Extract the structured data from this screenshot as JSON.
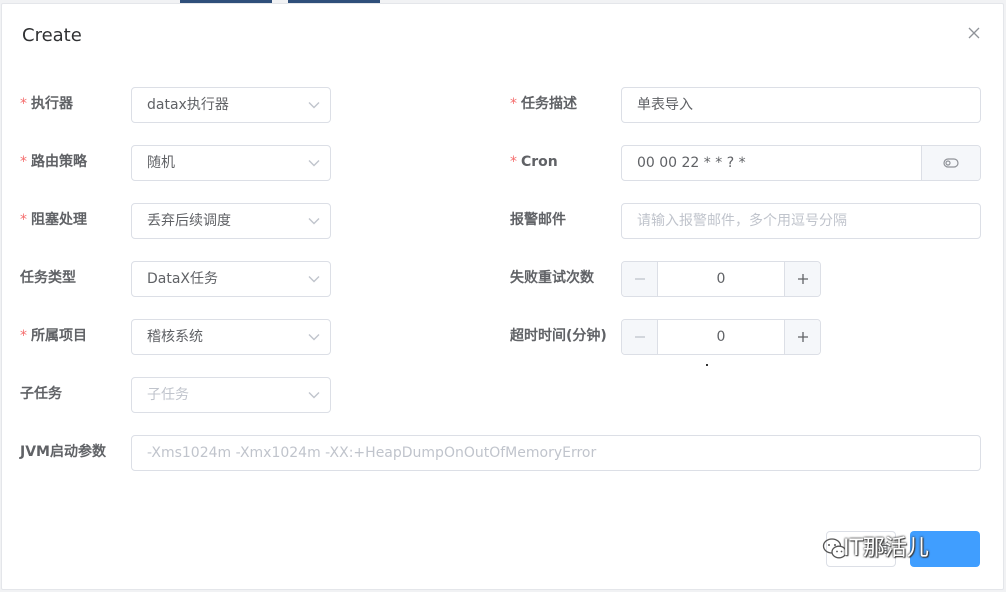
{
  "dialog": {
    "title": "Create",
    "close_icon": "close-icon"
  },
  "left": {
    "executor": {
      "label": "执行器",
      "required": "*",
      "value": "datax执行器"
    },
    "route": {
      "label": "路由策略",
      "required": "*",
      "value": "随机"
    },
    "block": {
      "label": "阻塞处理",
      "required": "*",
      "value": "丢弃后续调度"
    },
    "task_type": {
      "label": "任务类型",
      "value": "DataX任务"
    },
    "project": {
      "label": "所属项目",
      "required": "*",
      "value": "稽核系统"
    },
    "subtask": {
      "label": "子任务",
      "placeholder": "子任务"
    }
  },
  "right": {
    "desc": {
      "label": "任务描述",
      "required": "*",
      "value": "单表导入"
    },
    "cron": {
      "label": "Cron",
      "required": "*",
      "value": "00 00 22 * * ? *"
    },
    "alarm": {
      "label": "报警邮件",
      "placeholder": "请输入报警邮件，多个用逗号分隔"
    },
    "retry": {
      "label": "失败重试次数",
      "value": "0"
    },
    "timeout": {
      "label": "超时时间(分钟)",
      "value": "0"
    }
  },
  "jvm": {
    "label": "JVM启动参数",
    "placeholder": "-Xms1024m -Xmx1024m -XX:+HeapDumpOnOutOfMemoryError"
  },
  "footer": {
    "cancel_partial": "消",
    "watermark": "IT那活儿"
  },
  "colors": {
    "primary": "#409eff",
    "required": "#f56c6c",
    "border": "#dcdfe6",
    "background_top_strip": "#2f4f7a"
  }
}
